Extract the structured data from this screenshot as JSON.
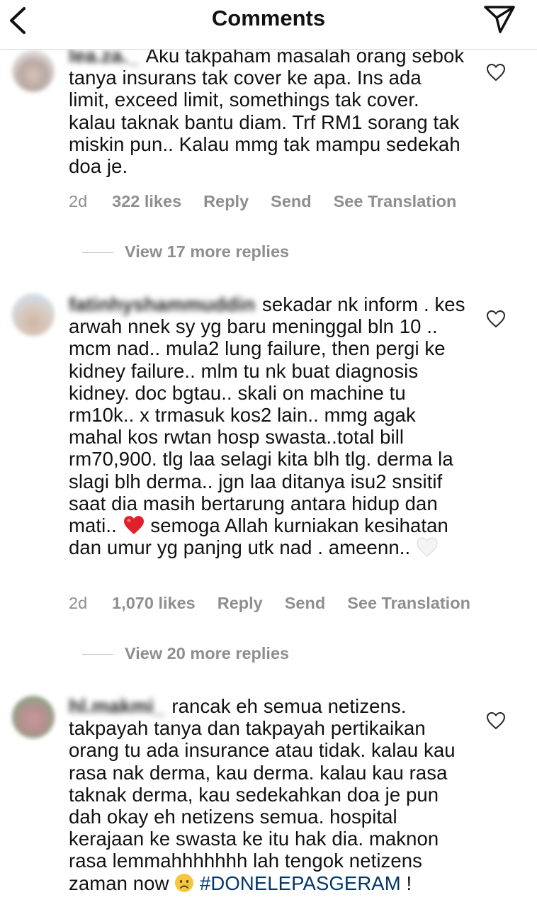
{
  "header": {
    "title": "Comments",
    "back_icon": "chevron-left-icon",
    "send_icon": "direct-send-icon"
  },
  "comments": [
    {
      "username": "lea.za._",
      "text": "Aku takpaham masalah orang sebok tanya insurans tak cover ke apa. Ins ada limit, exceed limit, somethings tak cover. kalau taknak bantu diam. Trf RM1 sorang tak miskin pun.. Kalau mmg tak mampu sedekah doa je.",
      "time": "2d",
      "likes": "322 likes",
      "reply": "Reply",
      "send": "Send",
      "translate": "See Translation",
      "view_replies": "View 17 more replies"
    },
    {
      "username": "fatinhyshammuddin",
      "text_part1": "sekadar nk inform . kes arwah nnek sy yg baru meninggal bln 10 .. mcm nad.. mula2 lung failure, then pergi ke kidney failure.. mlm tu nk buat diagnosis kidney. doc bgtau.. skali on machine tu rm10k.. x trmasuk kos2 lain.. mmg agak mahal kos rwtan hosp swasta..total bill rm70,900. tlg laa selagi kita blh tlg. derma la slagi blh derma.. jgn laa ditanya isu2 snsitif saat dia masih bertarung antara hidup dan mati..",
      "text_part2": "semoga Allah kurniakan kesihatan dan umur yg panjng utk nad . ameenn..",
      "time": "2d",
      "likes": "1,070 likes",
      "reply": "Reply",
      "send": "Send",
      "translate": "See Translation",
      "view_replies": "View 20 more replies"
    },
    {
      "username": "hl.makmi_",
      "text": "rancak eh semua netizens. takpayah tanya dan takpayah pertikaikan orang tu ada insurance atau tidak. kalau kau rasa nak derma, kau derma. kalau kau rasa taknak derma, kau sedekahkan doa je pun dah okay eh netizens semua. hospital kerajaan ke swasta ke itu hak dia. maknon rasa lemmahhhhhhh lah tengok netizens zaman now",
      "hashtag": "#DONELEPASGERAM",
      "end": " !"
    }
  ],
  "colors": {
    "text": "#111111",
    "meta": "#8e8e8e",
    "hashtag": "#00376b",
    "divider": "#dbdbdb"
  }
}
